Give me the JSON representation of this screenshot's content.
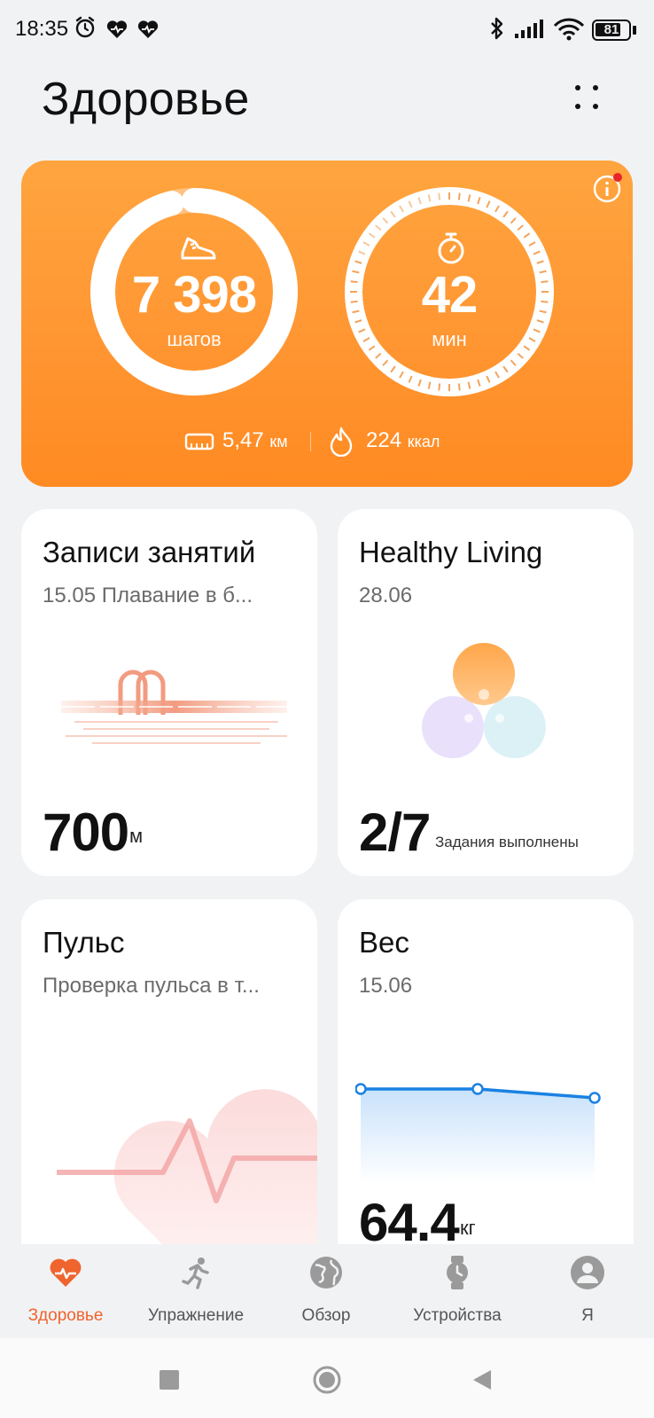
{
  "status_bar": {
    "time": "18:35",
    "battery": "81"
  },
  "header": {
    "title": "Здоровье"
  },
  "activity": {
    "steps": "7 398",
    "steps_unit": "шагов",
    "minutes": "42",
    "minutes_unit": "мин",
    "distance": "5,47",
    "distance_unit": "км",
    "calories": "224",
    "calories_unit": "ккал",
    "steps_progress": 0.96,
    "minutes_progress": 0.82
  },
  "cards": {
    "workout": {
      "title": "Записи занятий",
      "subtitle": "15.05 Плавание в б...",
      "value": "700",
      "unit": "м"
    },
    "healthy": {
      "title": "Healthy Living",
      "subtitle": "28.06",
      "value": "2/7",
      "caption": "Задания выполнены"
    },
    "pulse": {
      "title": "Пульс",
      "subtitle": "Проверка пульса в т..."
    },
    "weight": {
      "title": "Вес",
      "subtitle": "15.06",
      "value": "64.4",
      "unit": "кг"
    }
  },
  "nav": {
    "items": [
      {
        "label": "Здоровье",
        "icon": "heart-icon",
        "active": true
      },
      {
        "label": "Упражнение",
        "icon": "runner-icon",
        "active": false
      },
      {
        "label": "Обзор",
        "icon": "globe-icon",
        "active": false
      },
      {
        "label": "Устройства",
        "icon": "watch-icon",
        "active": false
      },
      {
        "label": "Я",
        "icon": "profile-icon",
        "active": false
      }
    ]
  },
  "colors": {
    "accent": "#ff9632",
    "nav_active": "#f0642e",
    "chart_line": "#1a82e2"
  }
}
